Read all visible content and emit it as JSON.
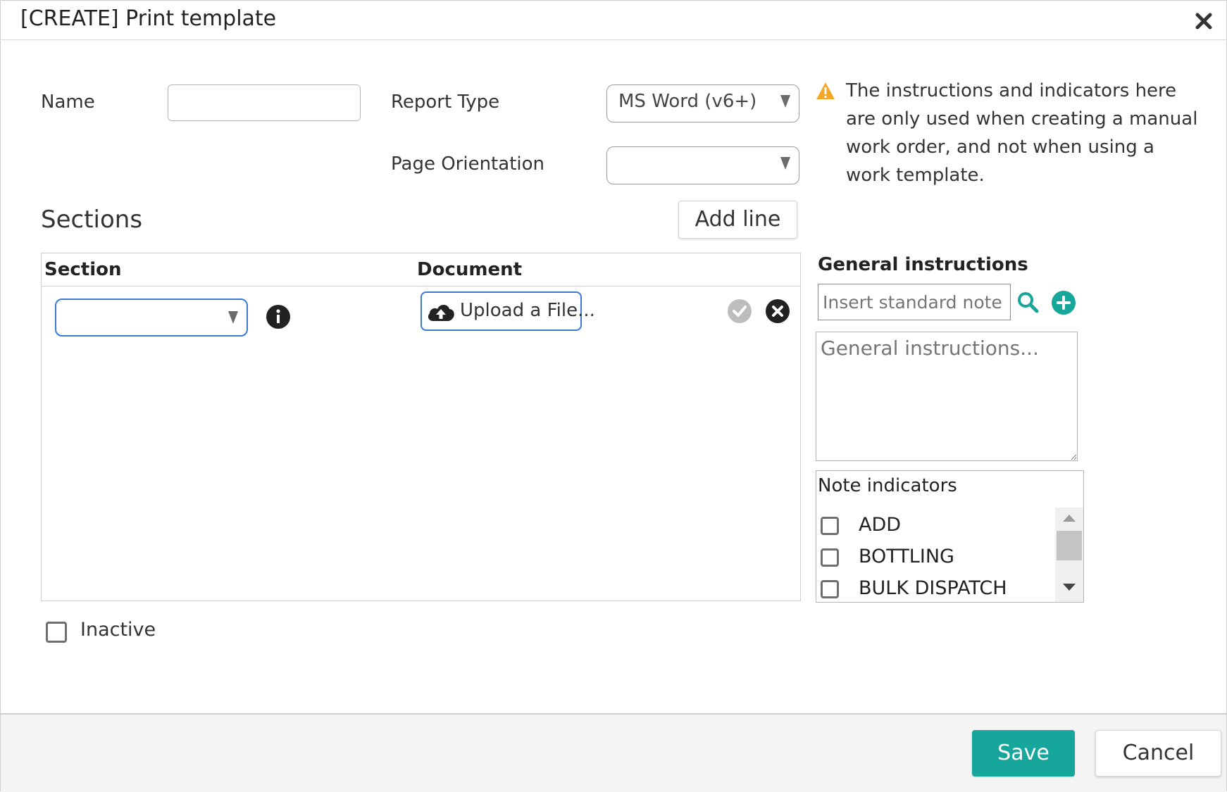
{
  "dialog": {
    "title": "[CREATE] Print template"
  },
  "form": {
    "name_label": "Name",
    "name_value": "",
    "report_type_label": "Report Type",
    "report_type_value": "MS Word (v6+)",
    "page_orientation_label": "Page Orientation",
    "page_orientation_value": ""
  },
  "warning": {
    "text": "The instructions and indicators here are only used when creating a manual work order, and not when using a work template."
  },
  "sections": {
    "heading": "Sections",
    "add_line_label": "Add line",
    "columns": [
      "Section",
      "Document"
    ],
    "row": {
      "section_value": "",
      "upload_label": "Upload a File..."
    }
  },
  "general_instructions": {
    "heading": "General instructions",
    "standard_note_placeholder": "Insert standard note",
    "textarea_placeholder": "General instructions..."
  },
  "note_indicators": {
    "heading": "Note indicators",
    "items": [
      "ADD",
      "BOTTLING",
      "BULK DISPATCH"
    ]
  },
  "inactive_label": "Inactive",
  "footer": {
    "save_label": "Save",
    "cancel_label": "Cancel"
  },
  "colors": {
    "accent": "#17a69b",
    "warning": "#f5a623",
    "section_select_border": "#3b7bd6"
  }
}
